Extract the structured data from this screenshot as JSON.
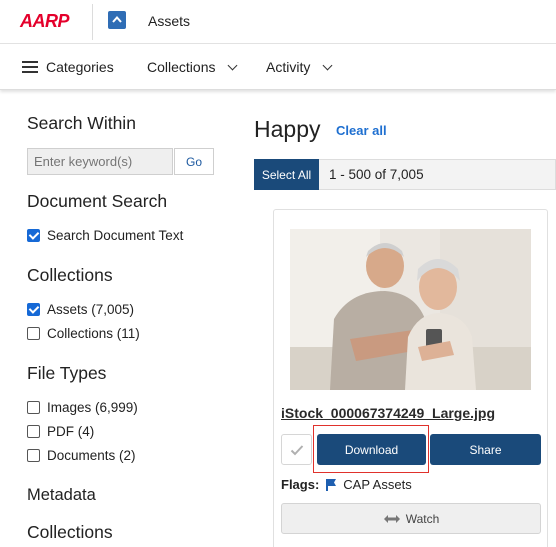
{
  "header": {
    "logo_text": "AARP",
    "app_title": "Assets",
    "app_icon": "chevron-up-icon"
  },
  "nav": {
    "categories": "Categories",
    "collections": "Collections",
    "activity": "Activity"
  },
  "sidebar": {
    "search_within_title": "Search Within",
    "keyword_placeholder": "Enter keyword(s)",
    "go_label": "Go",
    "document_search_title": "Document Search",
    "search_document_text": "Search Document Text",
    "collections_title": "Collections",
    "collections": [
      {
        "label": "Assets (7,005)",
        "checked": true
      },
      {
        "label": "Collections (11)",
        "checked": false
      }
    ],
    "file_types_title": "File Types",
    "file_types": [
      {
        "label": "Images (6,999)",
        "checked": false
      },
      {
        "label": "PDF (4)",
        "checked": false
      },
      {
        "label": "Documents (2)",
        "checked": false
      }
    ],
    "metadata_title": "Metadata",
    "metadata_collections_title": "Collections"
  },
  "main": {
    "query": "Happy",
    "clear_all": "Clear all",
    "select_all": "Select All",
    "result_range": "1 - 500 of 7,005",
    "card": {
      "file_name": "iStock_000067374249_Large.jpg",
      "download_label": "Download",
      "share_label": "Share",
      "flags_label": "Flags:",
      "flag_value": "CAP Assets",
      "watch_label": "Watch"
    }
  },
  "colors": {
    "brand_red": "#e4002b",
    "primary_button": "#1a4a7a",
    "link_blue": "#1e6fd0",
    "checkbox_blue": "#1669d6",
    "highlight_red": "#e0322c"
  }
}
